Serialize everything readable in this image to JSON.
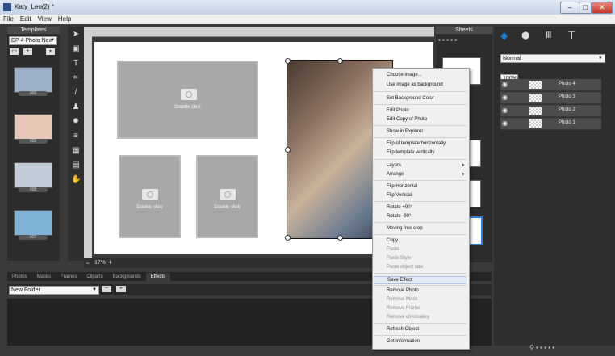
{
  "window": {
    "title": "Katy_Leo(2) *",
    "min": "–",
    "max": "□",
    "close": "✕"
  },
  "menu": [
    "File",
    "Edit",
    "View",
    "Help"
  ],
  "templates": {
    "header": "Templates",
    "dropdown": "DP 4 Photo New",
    "items": [
      "006",
      "005",
      "008",
      "007"
    ]
  },
  "canvas": {
    "slot_label": "Double click",
    "zoom": "17%"
  },
  "sheets": {
    "header": "Sheets"
  },
  "layers": {
    "blend": "Normal",
    "opacity": "100%",
    "items": [
      "Photo 4",
      "Photo 3",
      "Photo 2",
      "Photo 1"
    ]
  },
  "bottom_tabs": [
    "Photos",
    "Masks",
    "Frames",
    "Cliparts",
    "Backgrounds",
    "Effects"
  ],
  "active_tab": "Effects",
  "folder": {
    "value": "New Folder"
  },
  "context_menu": {
    "items": [
      {
        "label": "Choose image...",
        "enabled": true
      },
      {
        "label": "Use image as background",
        "enabled": true
      },
      {
        "label": "Set Background Color",
        "enabled": true
      },
      {
        "label": "Edit Photo",
        "enabled": true
      },
      {
        "label": "Edit Copy of Photo",
        "enabled": true
      },
      {
        "label": "Show in Explorer",
        "enabled": true
      },
      {
        "label": "Flip of template horizontally",
        "enabled": true
      },
      {
        "label": "Flip template vertically",
        "enabled": true
      },
      {
        "label": "Layers",
        "enabled": true,
        "submenu": true
      },
      {
        "label": "Arrange",
        "enabled": true,
        "submenu": true
      },
      {
        "label": "Flip Horizontal",
        "enabled": true
      },
      {
        "label": "Flip Vertical",
        "enabled": true
      },
      {
        "label": "Rotate +90°",
        "enabled": true
      },
      {
        "label": "Rotate -90°",
        "enabled": true
      },
      {
        "label": "Moving free crop",
        "enabled": true
      },
      {
        "label": "Copy",
        "enabled": true
      },
      {
        "label": "Paste",
        "enabled": false
      },
      {
        "label": "Paste Style",
        "enabled": false
      },
      {
        "label": "Paste object size",
        "enabled": false
      },
      {
        "label": "Save Effect",
        "enabled": true,
        "highlighted": true
      },
      {
        "label": "Remove Photo",
        "enabled": true
      },
      {
        "label": "Remove Mask",
        "enabled": false
      },
      {
        "label": "Remove Frame",
        "enabled": false
      },
      {
        "label": "Remove chromakey",
        "enabled": false
      },
      {
        "label": "Refresh Object",
        "enabled": true
      },
      {
        "label": "Get information",
        "enabled": true
      }
    ]
  }
}
